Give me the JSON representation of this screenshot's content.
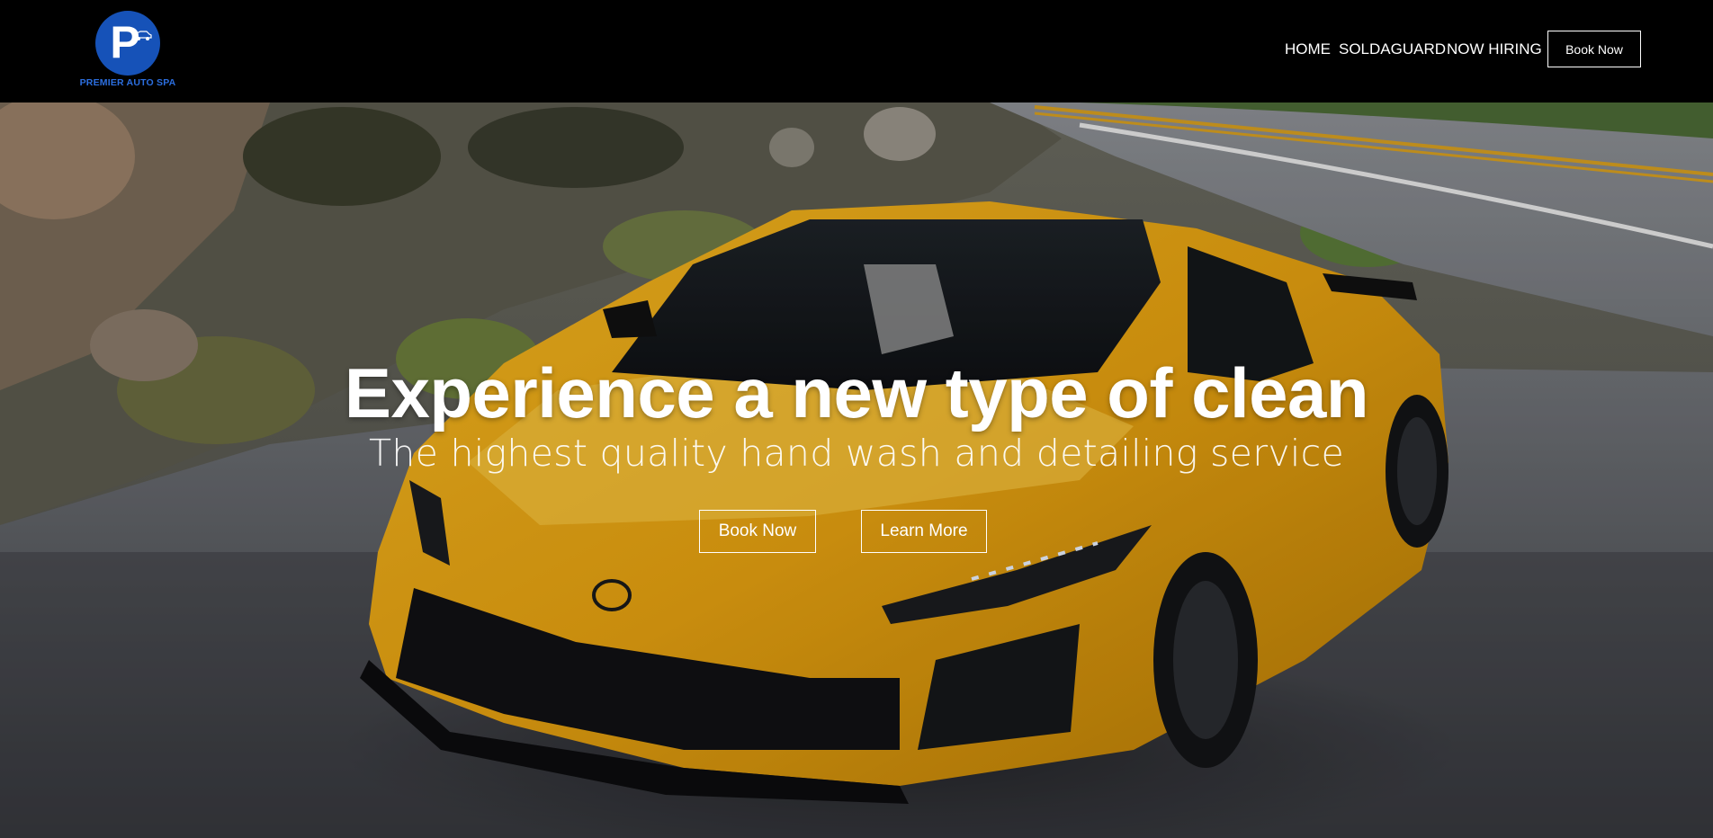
{
  "brand": {
    "logo_letter": "P",
    "name": "PREMIER AUTO SPA"
  },
  "nav": {
    "items": [
      {
        "label": "HOME"
      },
      {
        "label": "SOLDAGUARD"
      },
      {
        "label": "NOW HIRING"
      }
    ],
    "cta_label": "Book Now"
  },
  "hero": {
    "title": "Experience a new type of clean",
    "subtitle": "The highest quality hand wash and detailing service",
    "primary_button": "Book Now",
    "secondary_button": "Learn More",
    "background_image": "yellow-sports-car-on-desert-road"
  },
  "colors": {
    "header_bg": "#000000",
    "logo_blue": "#1652b8",
    "car_yellow": "#e6a312",
    "text": "#ffffff"
  }
}
